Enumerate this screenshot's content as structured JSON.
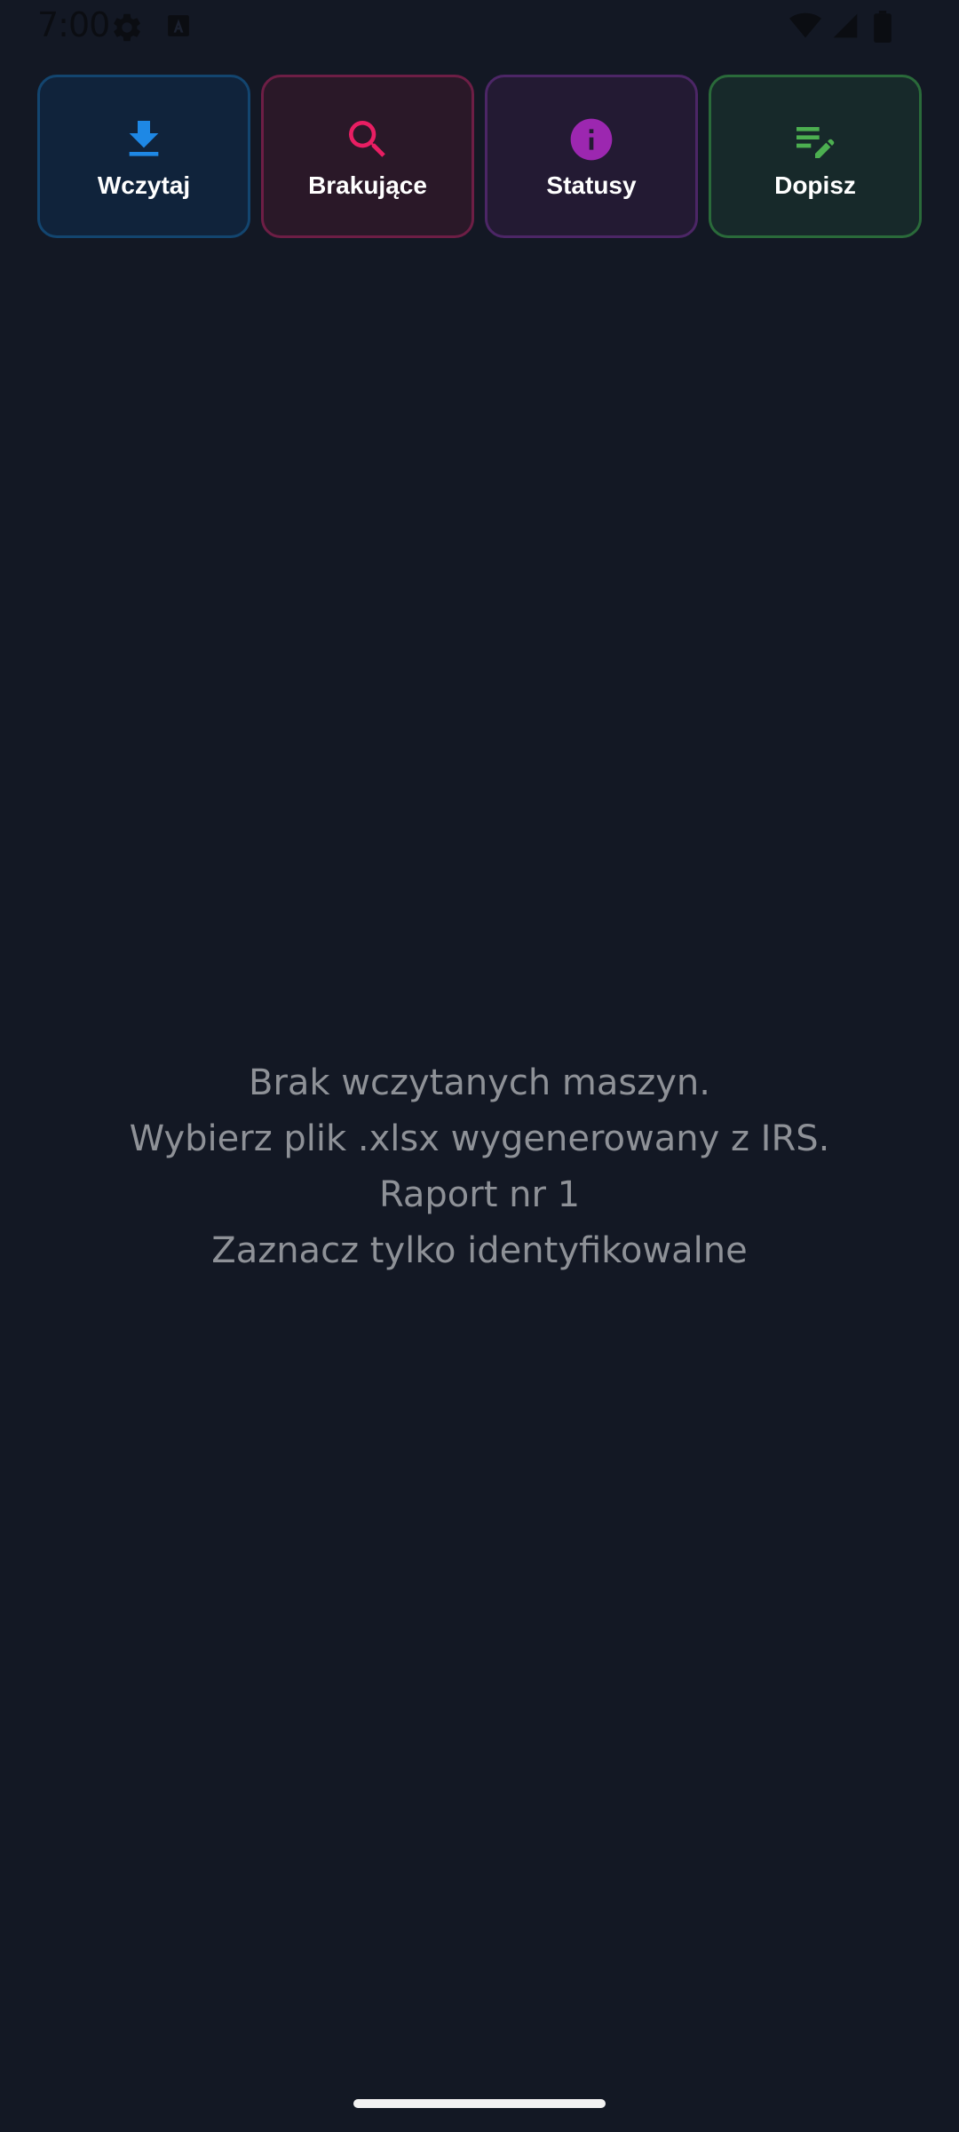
{
  "status_bar": {
    "time": "7:00",
    "icons": [
      "gear-icon",
      "a-badge-icon",
      "wifi-icon",
      "signal-icon",
      "battery-icon"
    ]
  },
  "actions": [
    {
      "label": "Wczytaj",
      "icon": "download-icon",
      "accent": "#1e88e5"
    },
    {
      "label": "Brakujące",
      "icon": "search-icon",
      "accent": "#e91e63"
    },
    {
      "label": "Statusy",
      "icon": "info-icon",
      "accent": "#9c27b0"
    },
    {
      "label": "Dopisz",
      "icon": "edit-list-icon",
      "accent": "#4caf50"
    }
  ],
  "empty_state": {
    "line1": "Brak wczytanych maszyn.",
    "line2": "Wybierz plik .xlsx wygenerowany z IRS.",
    "line3": "Raport nr 1",
    "line4": "Zaznacz tylko identyfikowalne"
  },
  "colors": {
    "background": "#131824",
    "text_muted": "#8e9197"
  }
}
